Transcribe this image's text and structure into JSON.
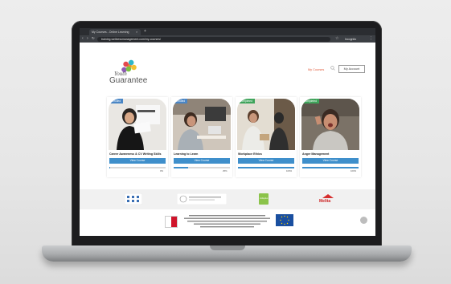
{
  "browser": {
    "tab_title": "My Courses - Online Learning",
    "tab_close": "×",
    "new_tab": "+",
    "back": "‹",
    "forward": "›",
    "reload": "↻",
    "url": "training.wellnessmanagement.com/my-courses/",
    "star": "☆",
    "profile_label": "Incognito",
    "menu": "⋮"
  },
  "header": {
    "logo_line1": "Youth",
    "logo_line2": "Guarantee",
    "my_courses_link": "My Courses",
    "my_account_button": "My Account"
  },
  "courses": [
    {
      "title": "Career Awareness & CV Writing Skills",
      "status": "Enrolled",
      "button": "View Course",
      "progress_text": "0%",
      "progress": 0.02
    },
    {
      "title": "Learning to Learn",
      "status": "Enrolled",
      "button": "View Course",
      "progress_text": "25%",
      "progress": 0.25
    },
    {
      "title": "Workplace Ethics",
      "status": "Completed",
      "button": "View Course",
      "progress_text": "100%",
      "progress": 1.0
    },
    {
      "title": "Anger Management",
      "status": "Completed",
      "button": "View Course",
      "progress_text": "100%",
      "progress": 1.0
    }
  ],
  "partners": {
    "melita": "Melita",
    "green_logo": "Jobsplus"
  },
  "colors": {
    "accent_blue": "#3f8fcb",
    "enrolled_badge": "#4a86c5",
    "completed_badge": "#3fa45b",
    "my_courses_link": "#e05a3a"
  }
}
